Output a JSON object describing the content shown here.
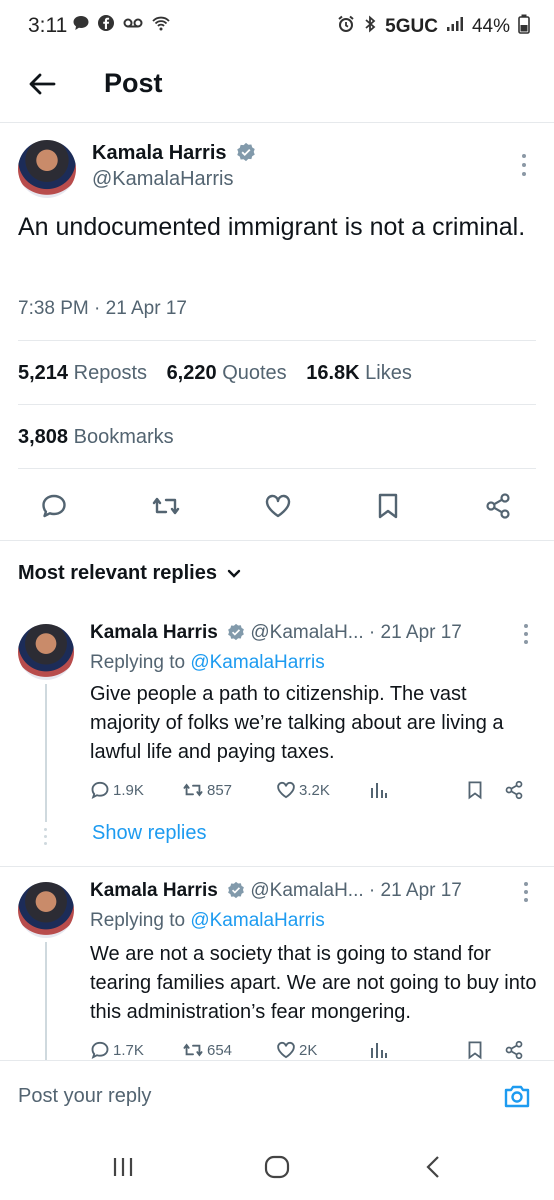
{
  "status_bar": {
    "time": "3:11",
    "network": "5GUC",
    "battery": "44%"
  },
  "header": {
    "title": "Post",
    "back_icon": "arrow-left-icon"
  },
  "post": {
    "author_name": "Kamala Harris",
    "author_handle": "@KamalaHarris",
    "verified": true,
    "text": "An undocumented immigrant is not a criminal.",
    "timestamp": "7:38 PM · 21 Apr 17",
    "reposts_count": "5,214",
    "reposts_label": "Reposts",
    "quotes_count": "6,220",
    "quotes_label": "Quotes",
    "likes_count": "16.8K",
    "likes_label": "Likes",
    "bookmarks_count": "3,808",
    "bookmarks_label": "Bookmarks"
  },
  "replies_filter": {
    "label": "Most relevant replies"
  },
  "replies": [
    {
      "author_name": "Kamala Harris",
      "author_handle": "@KamalaH...",
      "date": "· 21 Apr 17",
      "replying_to_label": "Replying to",
      "replying_to_handle": "@KamalaHarris",
      "text": "Give people a path to citizenship. The vast majority of folks we’re talking about are living a lawful life and paying taxes.",
      "replies": "1.9K",
      "reposts": "857",
      "likes": "3.2K",
      "show_replies": "Show replies"
    },
    {
      "author_name": "Kamala Harris",
      "author_handle": "@KamalaH...",
      "date": "· 21 Apr 17",
      "replying_to_label": "Replying to",
      "replying_to_handle": "@KamalaHarris",
      "text": "We are not a society that is going to stand for tearing families apart. We are not going to buy into this administration’s fear mongering.",
      "replies": "1.7K",
      "reposts": "654",
      "likes": "2K"
    }
  ],
  "composer": {
    "placeholder": "Post your reply"
  },
  "colors": {
    "accent": "#1d9bf0",
    "text_primary": "#0f1419",
    "text_secondary": "#536471",
    "divider": "#e6e9ec"
  }
}
